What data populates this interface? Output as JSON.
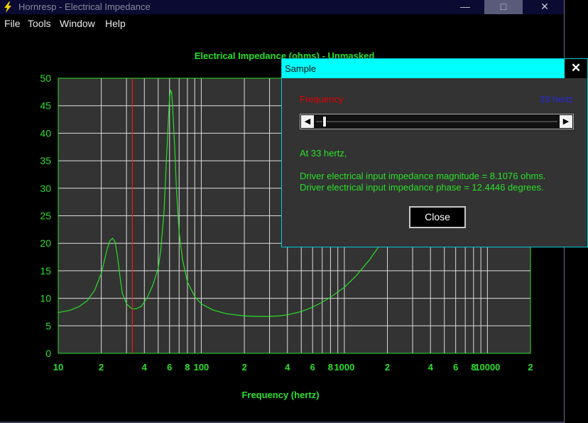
{
  "window": {
    "title": "Hornresp - Electrical Impedance",
    "minimize_glyph": "—",
    "maximize_glyph": "□",
    "close_glyph": "✕",
    "app_icon": "lightning-icon"
  },
  "menu": {
    "items": [
      "File",
      "Tools",
      "Window",
      "Help"
    ]
  },
  "chart_data": {
    "type": "line",
    "title": "Electrical Impedance (ohms) - Unmasked",
    "xlabel": "Frequency (hertz)",
    "ylabel": "",
    "xscale": "log",
    "xlim": [
      10,
      20000
    ],
    "ylim": [
      0,
      50
    ],
    "y_ticks": [
      0,
      5,
      10,
      15,
      20,
      25,
      30,
      35,
      40,
      45,
      50
    ],
    "x_tick_labels": [
      {
        "value": 10,
        "label": "10"
      },
      {
        "value": 20,
        "label": "2"
      },
      {
        "value": 40,
        "label": "4"
      },
      {
        "value": 60,
        "label": "6"
      },
      {
        "value": 80,
        "label": "8"
      },
      {
        "value": 100,
        "label": "100"
      },
      {
        "value": 200,
        "label": "2"
      },
      {
        "value": 400,
        "label": "4"
      },
      {
        "value": 600,
        "label": "6"
      },
      {
        "value": 800,
        "label": "8"
      },
      {
        "value": 1000,
        "label": "1000"
      },
      {
        "value": 2000,
        "label": "2"
      },
      {
        "value": 4000,
        "label": "4"
      },
      {
        "value": 6000,
        "label": "6"
      },
      {
        "value": 8000,
        "label": "8"
      },
      {
        "value": 10000,
        "label": "10000"
      },
      {
        "value": 20000,
        "label": "2"
      }
    ],
    "grid": true,
    "marker_frequency": 33,
    "colors": {
      "line": "#28e028",
      "marker": "#e02020",
      "grid": "#dcdcdc",
      "axis_text": "#28e028",
      "plot_bg": "#333333"
    },
    "series": [
      {
        "x": [
          10,
          12,
          14,
          16,
          18,
          20,
          22,
          23,
          24,
          25,
          26,
          27,
          28,
          30,
          32,
          33,
          35,
          38,
          42,
          46,
          50,
          52,
          55,
          57,
          59,
          60,
          61,
          62,
          63,
          65,
          67,
          70,
          74,
          80,
          90,
          100,
          120,
          150,
          200,
          250,
          300,
          350,
          400,
          500,
          600,
          700,
          800,
          1000,
          1200,
          1500,
          1700,
          2000
        ],
        "y": [
          7.4,
          7.8,
          8.5,
          9.6,
          11.5,
          14.5,
          19.0,
          20.5,
          20.9,
          20.2,
          17.5,
          14.0,
          11.0,
          9.0,
          8.3,
          8.1,
          8.1,
          8.5,
          10.2,
          12.5,
          15.5,
          18.5,
          26.0,
          35.0,
          43.0,
          46.5,
          47.8,
          47.5,
          45.0,
          38.0,
          30.0,
          22.0,
          17.0,
          13.0,
          10.3,
          9.0,
          7.9,
          7.2,
          6.8,
          6.7,
          6.7,
          6.8,
          7.0,
          7.6,
          8.4,
          9.3,
          10.2,
          12.0,
          14.0,
          17.0,
          19.0,
          22.0
        ]
      }
    ]
  },
  "dialog": {
    "title": "Sample",
    "close_glyph": "✕",
    "frequency_label": "Frequency",
    "frequency_value": "33 hertz",
    "slider_fraction": 0.01,
    "left_arrow": "◀",
    "right_arrow": "▶",
    "at_text": "At 33 hertz,",
    "magnitude_text": "Driver electrical input impedance magnitude = 8.1076 ohms.",
    "phase_text": "Driver electrical input impedance phase = 12.4446 degrees.",
    "close_label": "Close"
  }
}
